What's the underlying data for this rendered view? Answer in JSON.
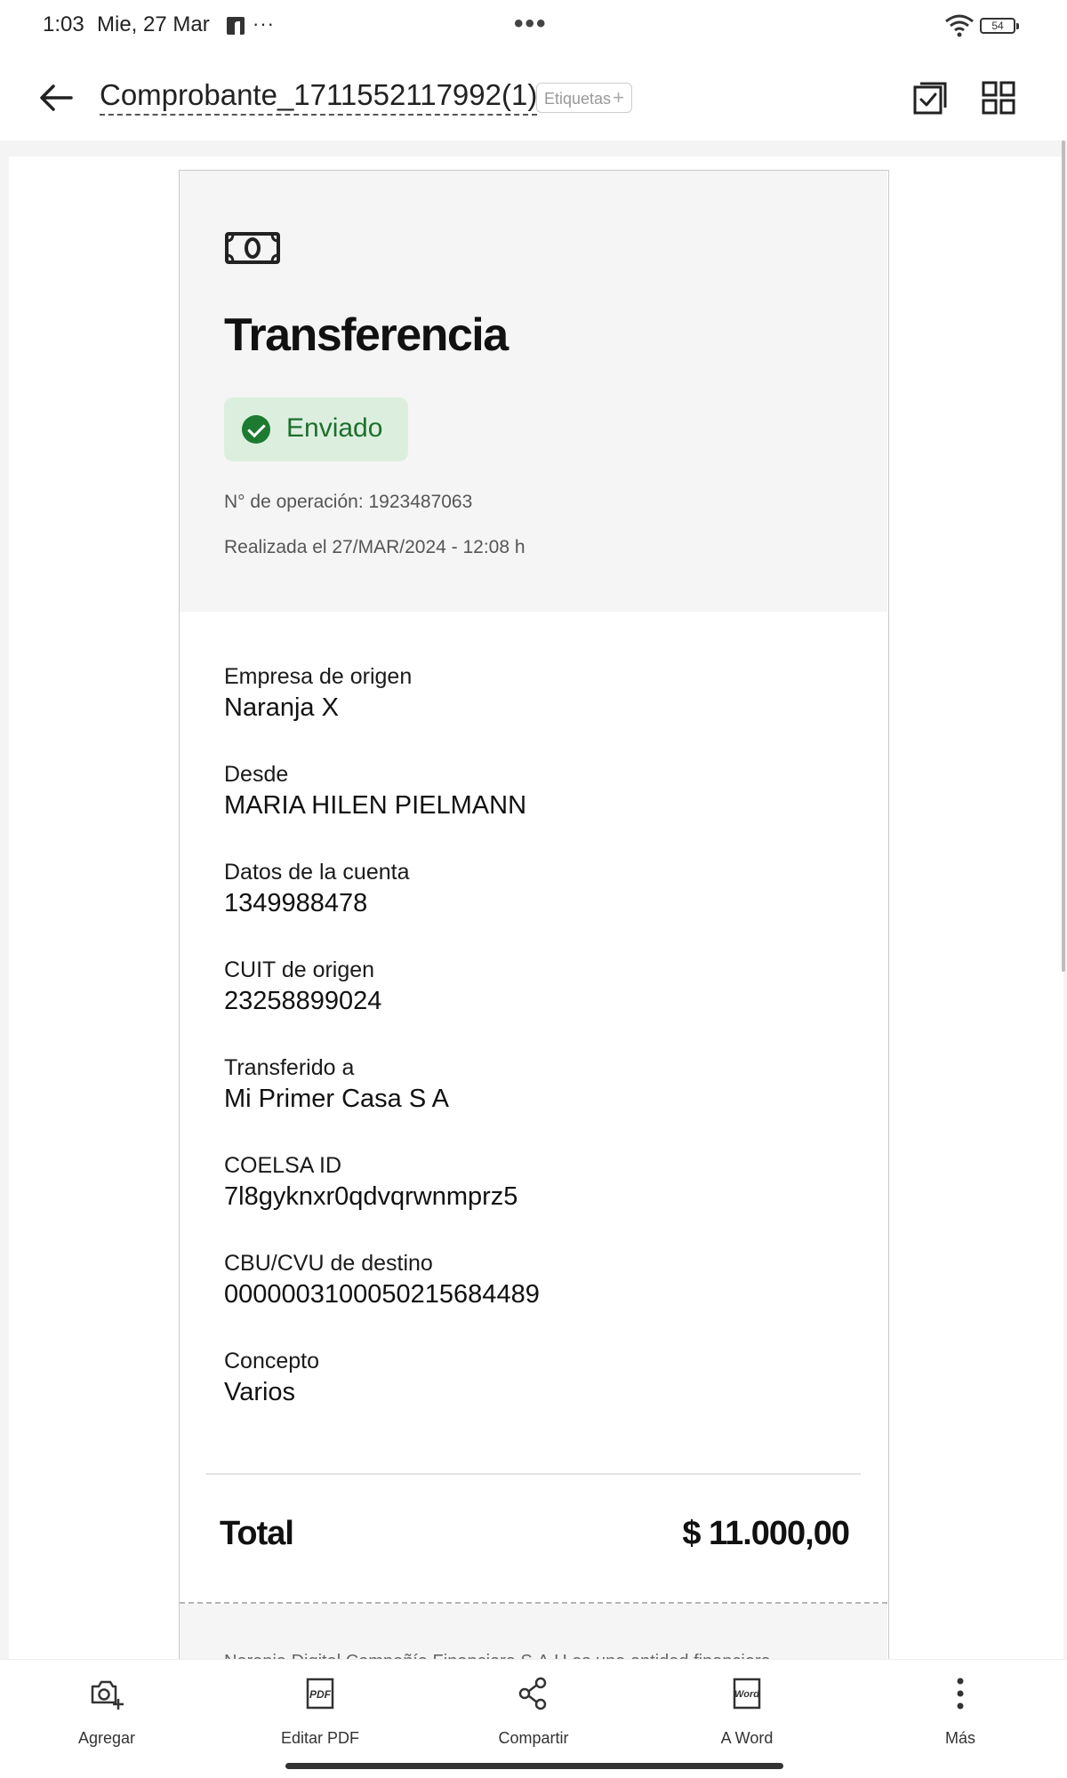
{
  "status_bar": {
    "time": "1:03",
    "date": "Mie, 27 Mar",
    "more_dots": "···",
    "center_dots": "•••",
    "battery": "54"
  },
  "app_bar": {
    "title": "Comprobante_1711552117992(1)",
    "tags_label": "Etiquetas",
    "tags_plus": "+"
  },
  "receipt": {
    "icon": "money-bill-icon",
    "title": "Transferencia",
    "status": "Enviado",
    "operation": "N° de operación: 1923487063",
    "date": "Realizada el 27/MAR/2024 - 12:08 h",
    "fields": [
      {
        "label": "Empresa de origen",
        "value": "Naranja X"
      },
      {
        "label": "Desde",
        "value": "MARIA HILEN PIELMANN"
      },
      {
        "label": "Datos de la cuenta",
        "value": "1349988478"
      },
      {
        "label": "CUIT de origen",
        "value": "23258899024"
      },
      {
        "label": "Transferido a",
        "value": "Mi Primer Casa S A"
      },
      {
        "label": "COELSA ID",
        "value": "7l8gyknxr0qdvqrwnmprz5"
      },
      {
        "label": "CBU/CVU de destino",
        "value": "0000003100050215684489"
      },
      {
        "label": "Concepto",
        "value": "Varios"
      }
    ],
    "total_label": "Total",
    "total_value": "$ 11.000,00",
    "footer_text": "Naranja Digital Compañía Financiera S.A.U es una entidad financiera"
  },
  "bottom_actions": [
    {
      "label": "Agregar",
      "icon": "camera-add-icon"
    },
    {
      "label": "Editar PDF",
      "icon": "pdf-edit-icon"
    },
    {
      "label": "Compartir",
      "icon": "share-icon"
    },
    {
      "label": "A Word",
      "icon": "word-icon"
    },
    {
      "label": "Más",
      "icon": "more-vertical-icon"
    }
  ],
  "colors": {
    "status_green": "#1d7b31",
    "status_bg": "#dcefdf",
    "header_gray": "#f5f5f5"
  }
}
